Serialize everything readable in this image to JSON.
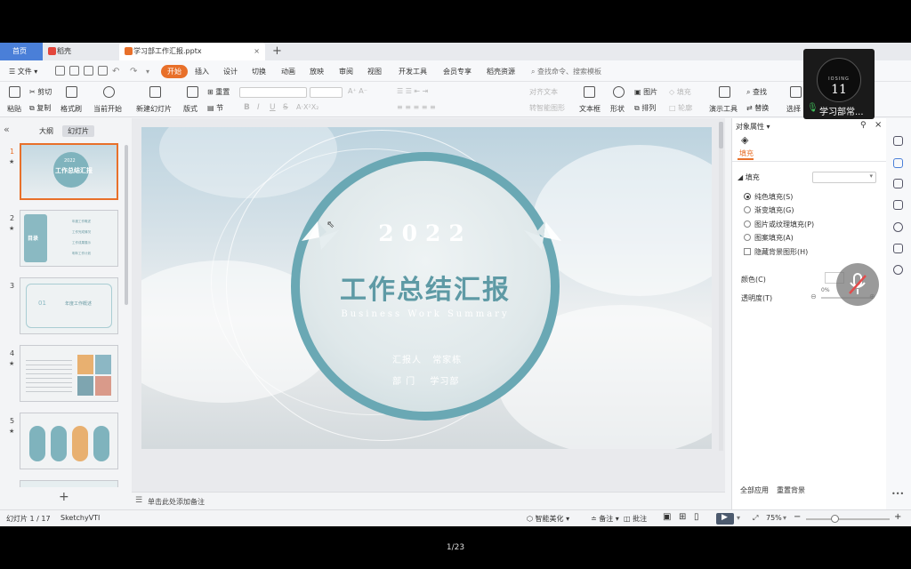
{
  "tabs": {
    "home": "首页",
    "wps": "稻壳",
    "doc": "学习部工作汇报.pptx",
    "close": "×",
    "add": "+"
  },
  "menu": {
    "file": "文件",
    "items": [
      "开始",
      "插入",
      "设计",
      "切换",
      "动画",
      "放映",
      "审阅",
      "视图",
      "开发工具",
      "会员专享",
      "稻壳资源"
    ],
    "search": "查找命令、搜索模板"
  },
  "ribbon": {
    "paste": "粘贴",
    "cut": "剪切",
    "copy": "复制",
    "format_painter": "格式刷",
    "play_from_current": "当前开始",
    "new_slide": "新建幻灯片",
    "layout": "版式",
    "section": "节",
    "reset": "重置",
    "font_size_hint": "A⁺ A⁻",
    "bold": "B",
    "italic": "I",
    "underline": "U",
    "strike": "S",
    "align_text": "对齐文本",
    "convert_smartart": "转智能图形",
    "textbox": "文本框",
    "shapes": "形状",
    "arrange": "排列",
    "picture": "图片",
    "fill": "填充",
    "outline": "轮廓",
    "presentation_tools": "演示工具",
    "find": "查找",
    "replace": "替换",
    "select": "选择"
  },
  "leftpanel": {
    "outline_tab": "大纲",
    "slides_tab": "幻灯片",
    "slide_numbers": [
      "1",
      "2",
      "3",
      "4",
      "5"
    ],
    "add": "+",
    "collapse": "«"
  },
  "thumbs": {
    "t1_year": "2022",
    "t1_title": "工作总结汇报",
    "t2_title": "目录",
    "t2_items": [
      "年度工作概述",
      "工作完成情况",
      "工作成果展示",
      "明年工作计划"
    ],
    "t3_num": "01",
    "t3_title": "年度工作概述"
  },
  "slide": {
    "year": "2022",
    "title": "工作总结汇报",
    "subtitle": "Business Work Summary",
    "reporter_label": "汇报人",
    "reporter_name": "常家栋",
    "dept_label": "部 门",
    "dept_name": "学习部"
  },
  "notes": {
    "placeholder": "单击此处添加备注"
  },
  "rightpanel": {
    "header": "对象属性",
    "fill_tab": "填充",
    "fill_section": "填充",
    "options": [
      "纯色填充(S)",
      "渐变填充(G)",
      "图片或纹理填充(P)",
      "图案填充(A)"
    ],
    "checkbox": "隐藏背景图形(H)",
    "color": "颜色(C)",
    "transparency": "透明度(T)",
    "transparency_value": "0%",
    "apply_all": "全部应用",
    "reset_bg": "重置背景",
    "more": "•••"
  },
  "statusbar": {
    "slide_info": "幻灯片 1 / 17",
    "theme": "SketchyVTI",
    "smart_beautify": "智能美化",
    "notes": "备注",
    "comments": "批注",
    "zoom": "75%",
    "minus": "−",
    "plus": "+"
  },
  "overlay": {
    "cam_line1": "IOSING",
    "cam_number": "11",
    "participant": "学习部常...",
    "pager": "1/23"
  },
  "colors": {
    "accent": "#e8702a",
    "teal": "#6aa8b4",
    "home_tab": "#4a7fd8"
  }
}
